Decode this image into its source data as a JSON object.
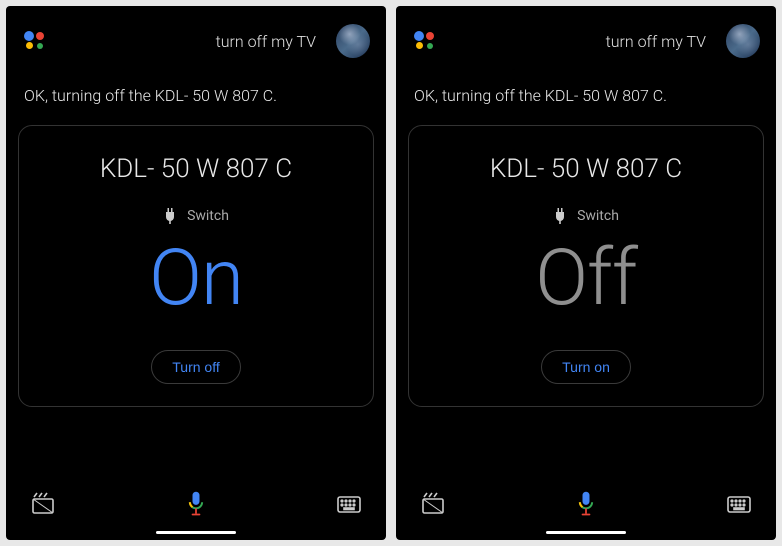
{
  "screens": [
    {
      "query": "turn off my TV",
      "response": "OK, turning off the KDL- 50 W 807 C.",
      "device_name": "KDL- 50 W 807 C",
      "device_type": "Switch",
      "state": "On",
      "state_class": "state-on",
      "action_label": "Turn off"
    },
    {
      "query": "turn off my TV",
      "response": "OK, turning off the KDL- 50 W 807 C.",
      "device_name": "KDL- 50 W 807 C",
      "device_type": "Switch",
      "state": "Off",
      "state_class": "state-off",
      "action_label": "Turn on"
    }
  ],
  "colors": {
    "on": "#4285f4",
    "off": "#8f8f8f",
    "accent": "#4285f4"
  }
}
